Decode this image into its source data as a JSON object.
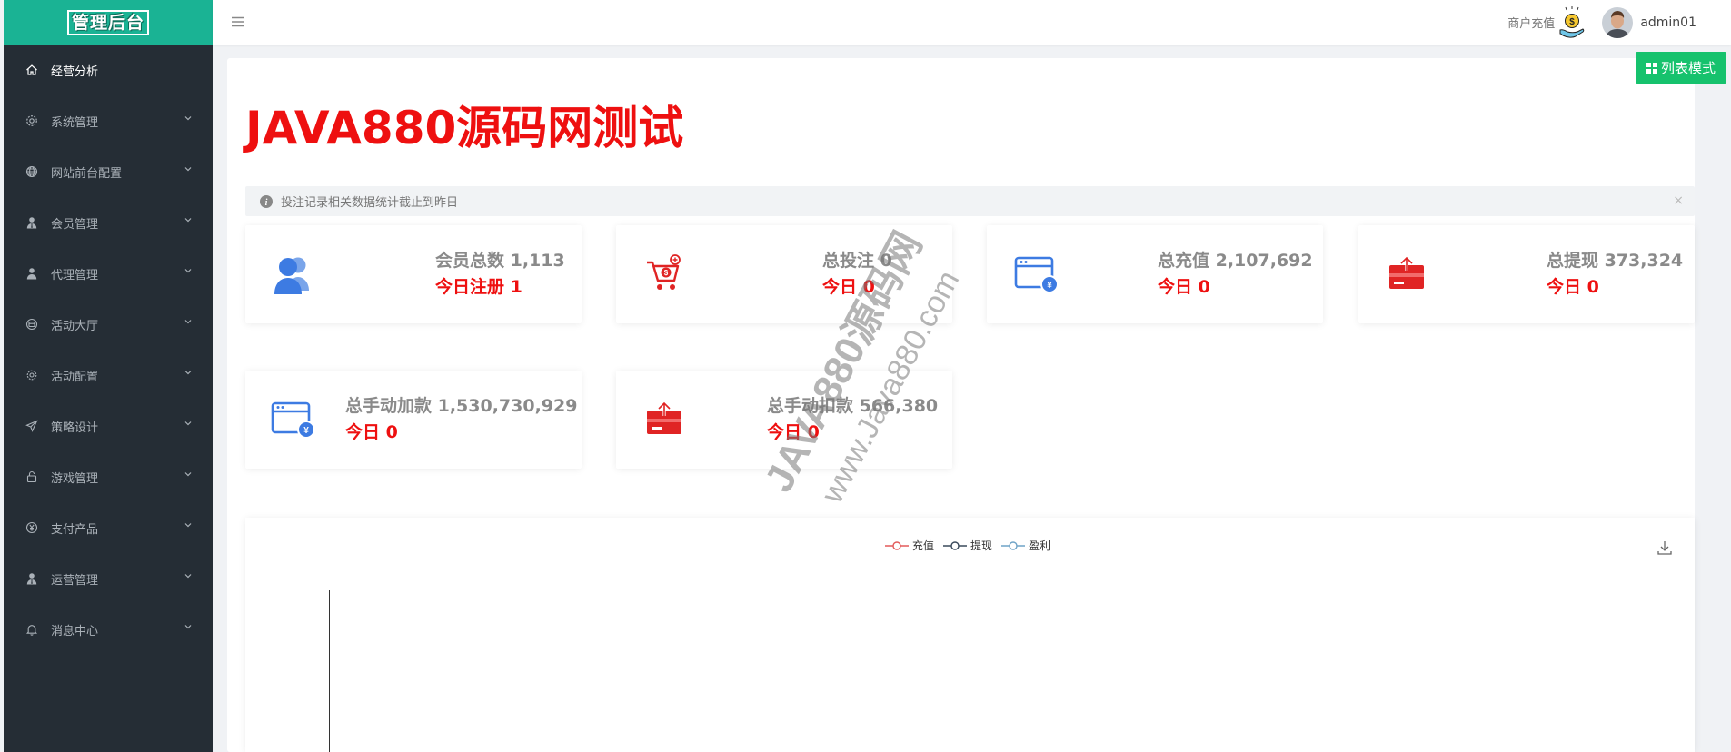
{
  "logo": {
    "text": "管理后台"
  },
  "sidebar": {
    "items": [
      {
        "label": "经营分析",
        "icon": "home-icon",
        "active": true
      },
      {
        "label": "系统管理",
        "icon": "gear-icon"
      },
      {
        "label": "网站前台配置",
        "icon": "globe-icon"
      },
      {
        "label": "会员管理",
        "icon": "user-tie-icon"
      },
      {
        "label": "代理管理",
        "icon": "user-icon"
      },
      {
        "label": "活动大厅",
        "icon": "calendar-icon"
      },
      {
        "label": "活动配置",
        "icon": "cog-icon"
      },
      {
        "label": "策略设计",
        "icon": "send-icon"
      },
      {
        "label": "游戏管理",
        "icon": "lock-icon"
      },
      {
        "label": "支付产品",
        "icon": "yen-circle-icon"
      },
      {
        "label": "运营管理",
        "icon": "user-tie-icon"
      },
      {
        "label": "消息中心",
        "icon": "bell-icon"
      }
    ]
  },
  "header": {
    "merchant_recharge": "商户充值",
    "username": "admin01"
  },
  "toolbar": {
    "list_mode": "列表模式"
  },
  "page": {
    "title": "JAVA880源码网测试"
  },
  "alert": {
    "text": "投注记录相关数据统计截止到昨日",
    "close": "×"
  },
  "cards": [
    {
      "total": "会员总数 1,113",
      "today": "今日注册 1",
      "icon": "users-icon",
      "color": "#3d7be2"
    },
    {
      "total": "总投注 0",
      "today": "今日 0",
      "icon": "cart-icon",
      "color": "#e02424"
    },
    {
      "total": "总充值 2,107,692",
      "today": "今日 0",
      "icon": "browser-yen-icon",
      "color": "#3d7be2"
    },
    {
      "total": "总提现 373,324",
      "today": "今日 0",
      "icon": "wallet-upload-icon",
      "color": "#e02424"
    },
    {
      "total": "总手动加款 1,530,730,929",
      "today": "今日 0",
      "icon": "browser-yen-icon",
      "color": "#3d7be2"
    },
    {
      "total": "总手动扣款 566,380",
      "today": "今日 0",
      "icon": "wallet-upload-icon",
      "color": "#e02424"
    }
  ],
  "chart_data": {
    "type": "line",
    "series": [
      {
        "name": "充值",
        "color": "#e35a5a",
        "values": []
      },
      {
        "name": "提现",
        "color": "#3a4a5c",
        "values": []
      },
      {
        "name": "盈利",
        "color": "#6fa3c7",
        "values": []
      }
    ],
    "x": []
  },
  "watermark": {
    "line1": "JAVA880源码网",
    "line2": "www.Java880.com"
  },
  "colors": {
    "accent": "#1ab394",
    "sidebar_bg": "#252d35",
    "title_red": "#ee1010",
    "button_green": "#16c26d"
  }
}
